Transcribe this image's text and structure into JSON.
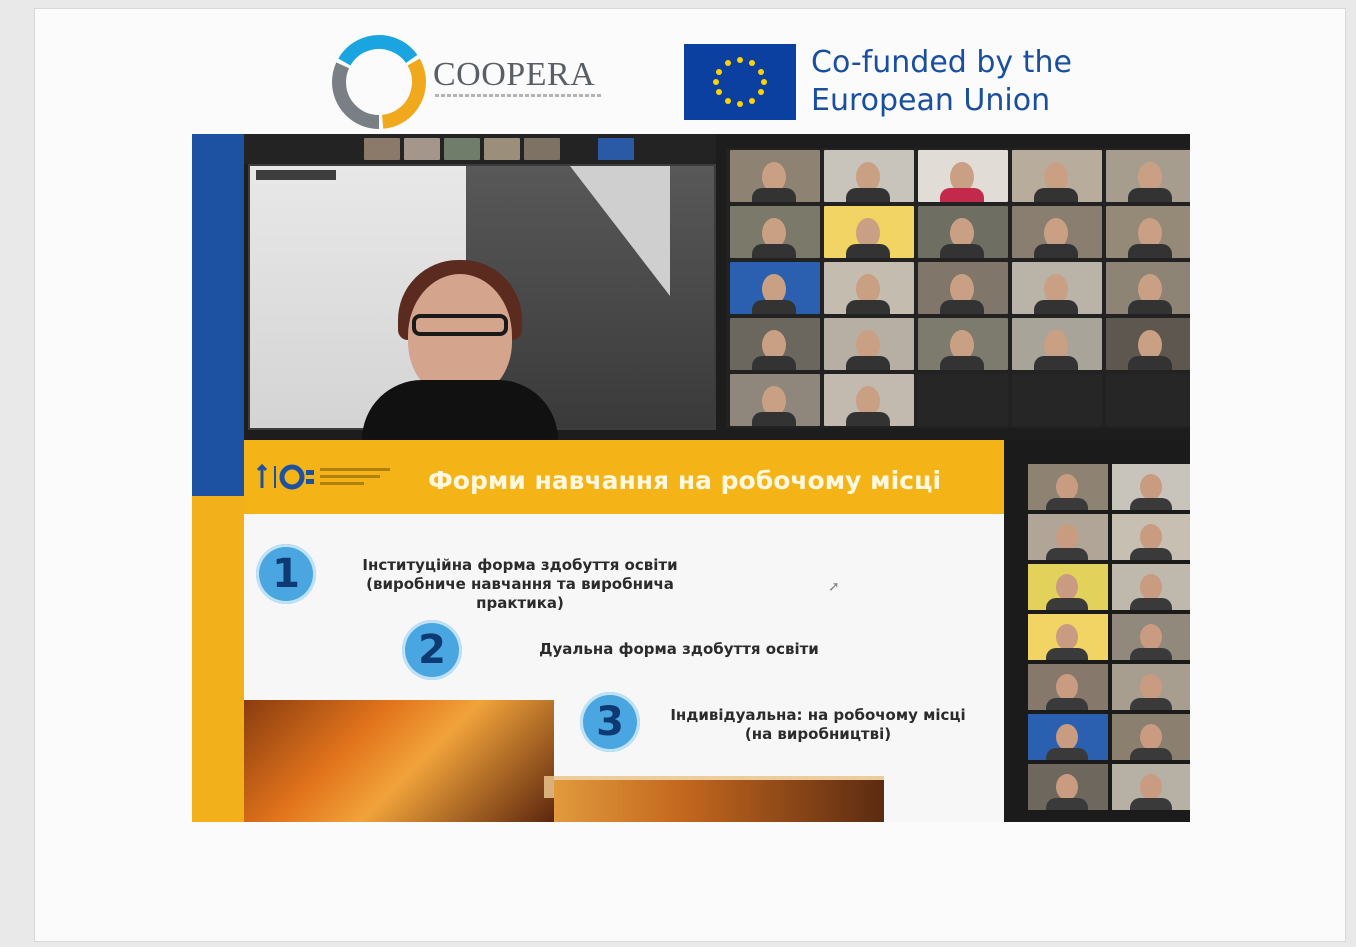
{
  "header": {
    "coopera_logo_text": "COOPERA",
    "eu_line1": "Co-funded by the",
    "eu_line2": "European Union"
  },
  "slide": {
    "title": "Форми навчання на робочому місці",
    "items": [
      {
        "number": "1",
        "line1": "Інституційна форма здобуття освіти",
        "line2": "(виробниче навчання та виробнича",
        "line3": "практика)"
      },
      {
        "number": "2",
        "line1": "Дуальна форма здобуття освіти"
      },
      {
        "number": "3",
        "line1": "Індивідуальна: на робочому місці",
        "line2": "(на виробництві)"
      }
    ]
  },
  "colors": {
    "eu_blue": "#1a4f9f",
    "slide_yellow": "#f4b418",
    "circle_blue": "#4aa6e0",
    "left_bar_blue": "#1d52a3"
  }
}
